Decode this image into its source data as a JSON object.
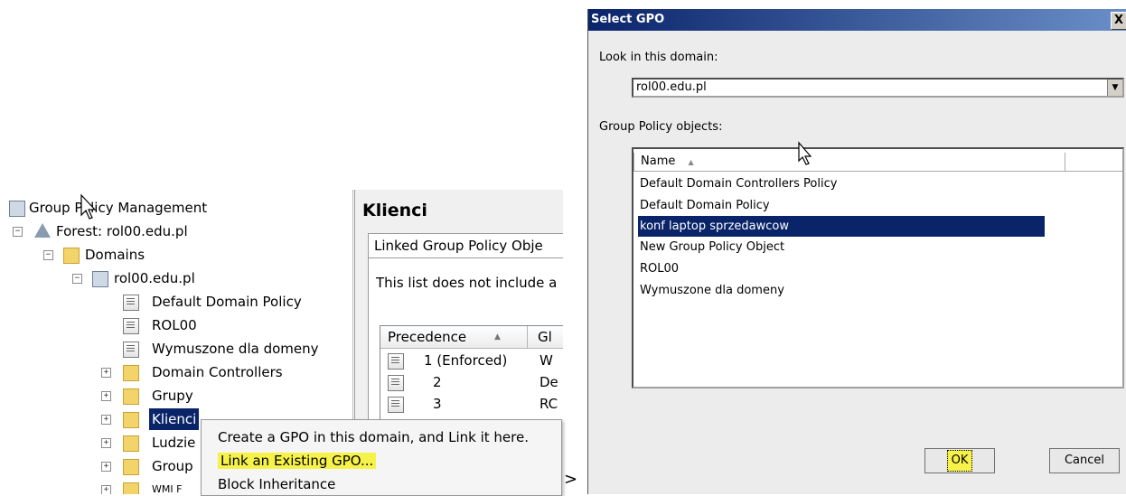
{
  "tree": {
    "root": "Group Policy Management",
    "forest": "Forest: rol00.edu.pl",
    "domains": "Domains",
    "domain": "rol00.edu.pl",
    "items": [
      {
        "label": "Default Domain Policy"
      },
      {
        "label": "ROL00"
      },
      {
        "label": "Wymuszone dla domeny"
      },
      {
        "label": "Domain Controllers"
      },
      {
        "label": "Grupy"
      },
      {
        "label": "Klienci"
      },
      {
        "label": "Ludzie"
      },
      {
        "label": "Group"
      },
      {
        "label": "WMI F"
      }
    ]
  },
  "panel": {
    "title": "Klienci",
    "tab": "Linked Group Policy Obje",
    "note": "This list does not include a",
    "headers": [
      "Precedence",
      "Gl"
    ],
    "rows": [
      {
        "precedence": "1 (Enforced)",
        "name": "W"
      },
      {
        "precedence": "2",
        "name": "De"
      },
      {
        "precedence": "3",
        "name": "RC"
      }
    ]
  },
  "context_menu": {
    "items": [
      "Create a GPO in this domain, and Link it here.",
      "Link an Existing GPO...",
      "Block Inheritance"
    ]
  },
  "separator": ">",
  "dialog": {
    "title": "Select GPO",
    "close": "X",
    "look_in_label": "Look in this domain:",
    "domain_value": "rol00.edu.pl",
    "gpo_label": "Group Policy objects:",
    "column_name": "Name",
    "gpos": [
      "Default Domain Controllers Policy",
      "Default Domain Policy",
      "konf laptop sprzedawcow",
      "New Group Policy Object",
      "ROL00",
      "Wymuszone dla domeny"
    ],
    "selected_index": 2,
    "ok": "OK",
    "cancel": "Cancel"
  },
  "colors": {
    "selection": "#0a246a",
    "highlight": "#f7f24a",
    "title_gradient_start": "#0a246a"
  }
}
